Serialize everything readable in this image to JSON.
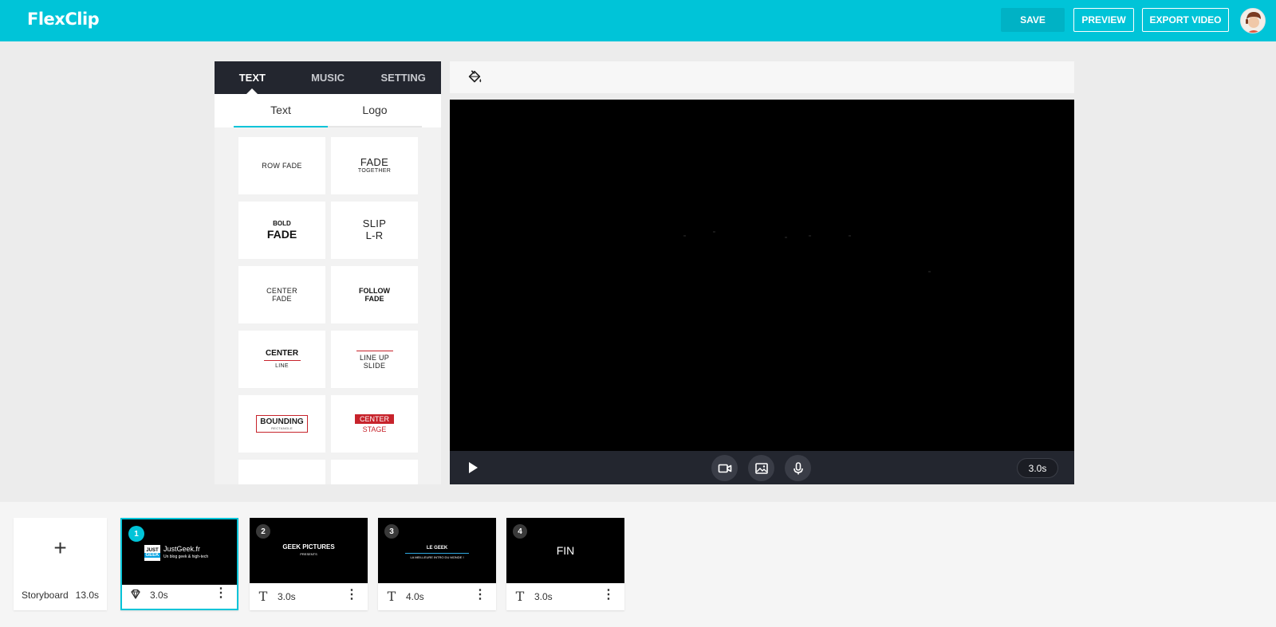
{
  "app": {
    "logo": "FlexClip"
  },
  "header": {
    "save": "SAVE",
    "preview": "PREVIEW",
    "export": "EXPORT VIDEO"
  },
  "panel": {
    "tabs": [
      "TEXT",
      "MUSIC",
      "SETTING"
    ],
    "active_tab": "TEXT",
    "sub_tabs": [
      "Text",
      "Logo"
    ],
    "active_sub_tab": "Text",
    "tiles": {
      "row_fade": "ROW FADE",
      "fade_together_1": "FADE",
      "fade_together_2": "TOGETHER",
      "bold_fade_1": "BOLD",
      "bold_fade_2": "FADE",
      "slip_1": "SLIP",
      "slip_2": "L-R",
      "center_fade_1": "CENTER",
      "center_fade_2": "FADE",
      "follow_fade_1": "FOLLOW",
      "follow_fade_2": "FADE",
      "center_line_1": "CENTER",
      "center_line_2": "LINE",
      "line_up_1": "LINE UP",
      "line_up_2": "SLIDE",
      "bounding_1": "BOUNDING",
      "bounding_2": "RECTANGLE",
      "center_stage_1": "CENTER",
      "center_stage_2": "STAGE"
    }
  },
  "player": {
    "duration": "3.0s"
  },
  "storyboard": {
    "label": "Storyboard",
    "total": "13.0s",
    "add_symbol": "+",
    "scenes": [
      {
        "num": "1",
        "duration": "3.0s",
        "type": "logo",
        "title": "JustGeek.fr",
        "subtitle": "Un blog geek & high-tech",
        "logo_top": "JUST",
        "logo_bottom": "GEEK"
      },
      {
        "num": "2",
        "duration": "3.0s",
        "type": "text",
        "title": "GEEK PICTURES",
        "subtitle": "PRESENTS"
      },
      {
        "num": "3",
        "duration": "4.0s",
        "type": "text",
        "title": "LE GEEK",
        "subtitle": "LA MEILLEURE INTRO DU MONDE !"
      },
      {
        "num": "4",
        "duration": "3.0s",
        "type": "text",
        "title": "FIN"
      }
    ]
  },
  "colors": {
    "accent": "#00c4d8",
    "dark": "#23262f",
    "red": "#c7232b"
  },
  "icons": [
    "paint-bucket-icon",
    "play-icon",
    "video-camera-icon",
    "image-icon",
    "microphone-icon",
    "diamond-icon",
    "text-icon",
    "more-vertical-icon"
  ]
}
